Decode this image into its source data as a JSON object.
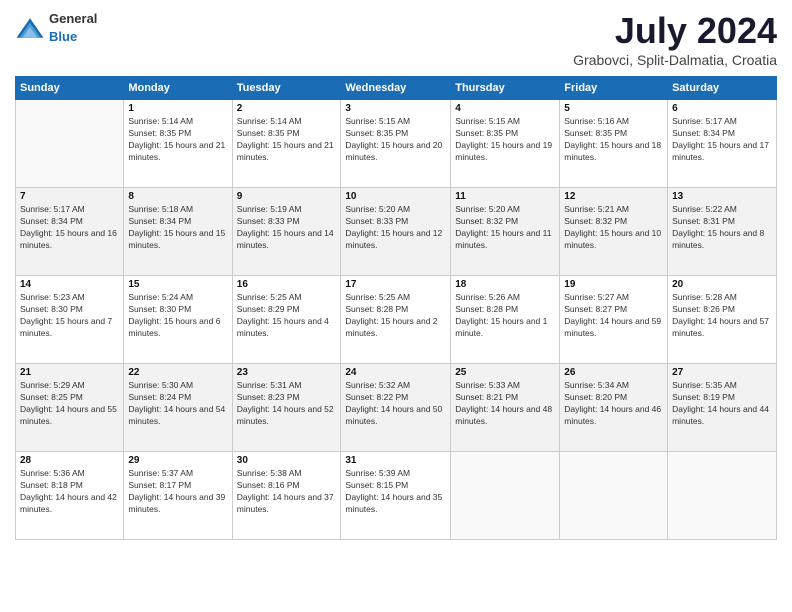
{
  "logo": {
    "general": "General",
    "blue": "Blue"
  },
  "title": "July 2024",
  "subtitle": "Grabovci, Split-Dalmatia, Croatia",
  "weekdays": [
    "Sunday",
    "Monday",
    "Tuesday",
    "Wednesday",
    "Thursday",
    "Friday",
    "Saturday"
  ],
  "weeks": [
    [
      {
        "day": "",
        "sunrise": "",
        "sunset": "",
        "daylight": ""
      },
      {
        "day": "1",
        "sunrise": "Sunrise: 5:14 AM",
        "sunset": "Sunset: 8:35 PM",
        "daylight": "Daylight: 15 hours and 21 minutes."
      },
      {
        "day": "2",
        "sunrise": "Sunrise: 5:14 AM",
        "sunset": "Sunset: 8:35 PM",
        "daylight": "Daylight: 15 hours and 21 minutes."
      },
      {
        "day": "3",
        "sunrise": "Sunrise: 5:15 AM",
        "sunset": "Sunset: 8:35 PM",
        "daylight": "Daylight: 15 hours and 20 minutes."
      },
      {
        "day": "4",
        "sunrise": "Sunrise: 5:15 AM",
        "sunset": "Sunset: 8:35 PM",
        "daylight": "Daylight: 15 hours and 19 minutes."
      },
      {
        "day": "5",
        "sunrise": "Sunrise: 5:16 AM",
        "sunset": "Sunset: 8:35 PM",
        "daylight": "Daylight: 15 hours and 18 minutes."
      },
      {
        "day": "6",
        "sunrise": "Sunrise: 5:17 AM",
        "sunset": "Sunset: 8:34 PM",
        "daylight": "Daylight: 15 hours and 17 minutes."
      }
    ],
    [
      {
        "day": "7",
        "sunrise": "Sunrise: 5:17 AM",
        "sunset": "Sunset: 8:34 PM",
        "daylight": "Daylight: 15 hours and 16 minutes."
      },
      {
        "day": "8",
        "sunrise": "Sunrise: 5:18 AM",
        "sunset": "Sunset: 8:34 PM",
        "daylight": "Daylight: 15 hours and 15 minutes."
      },
      {
        "day": "9",
        "sunrise": "Sunrise: 5:19 AM",
        "sunset": "Sunset: 8:33 PM",
        "daylight": "Daylight: 15 hours and 14 minutes."
      },
      {
        "day": "10",
        "sunrise": "Sunrise: 5:20 AM",
        "sunset": "Sunset: 8:33 PM",
        "daylight": "Daylight: 15 hours and 12 minutes."
      },
      {
        "day": "11",
        "sunrise": "Sunrise: 5:20 AM",
        "sunset": "Sunset: 8:32 PM",
        "daylight": "Daylight: 15 hours and 11 minutes."
      },
      {
        "day": "12",
        "sunrise": "Sunrise: 5:21 AM",
        "sunset": "Sunset: 8:32 PM",
        "daylight": "Daylight: 15 hours and 10 minutes."
      },
      {
        "day": "13",
        "sunrise": "Sunrise: 5:22 AM",
        "sunset": "Sunset: 8:31 PM",
        "daylight": "Daylight: 15 hours and 8 minutes."
      }
    ],
    [
      {
        "day": "14",
        "sunrise": "Sunrise: 5:23 AM",
        "sunset": "Sunset: 8:30 PM",
        "daylight": "Daylight: 15 hours and 7 minutes."
      },
      {
        "day": "15",
        "sunrise": "Sunrise: 5:24 AM",
        "sunset": "Sunset: 8:30 PM",
        "daylight": "Daylight: 15 hours and 6 minutes."
      },
      {
        "day": "16",
        "sunrise": "Sunrise: 5:25 AM",
        "sunset": "Sunset: 8:29 PM",
        "daylight": "Daylight: 15 hours and 4 minutes."
      },
      {
        "day": "17",
        "sunrise": "Sunrise: 5:25 AM",
        "sunset": "Sunset: 8:28 PM",
        "daylight": "Daylight: 15 hours and 2 minutes."
      },
      {
        "day": "18",
        "sunrise": "Sunrise: 5:26 AM",
        "sunset": "Sunset: 8:28 PM",
        "daylight": "Daylight: 15 hours and 1 minute."
      },
      {
        "day": "19",
        "sunrise": "Sunrise: 5:27 AM",
        "sunset": "Sunset: 8:27 PM",
        "daylight": "Daylight: 14 hours and 59 minutes."
      },
      {
        "day": "20",
        "sunrise": "Sunrise: 5:28 AM",
        "sunset": "Sunset: 8:26 PM",
        "daylight": "Daylight: 14 hours and 57 minutes."
      }
    ],
    [
      {
        "day": "21",
        "sunrise": "Sunrise: 5:29 AM",
        "sunset": "Sunset: 8:25 PM",
        "daylight": "Daylight: 14 hours and 55 minutes."
      },
      {
        "day": "22",
        "sunrise": "Sunrise: 5:30 AM",
        "sunset": "Sunset: 8:24 PM",
        "daylight": "Daylight: 14 hours and 54 minutes."
      },
      {
        "day": "23",
        "sunrise": "Sunrise: 5:31 AM",
        "sunset": "Sunset: 8:23 PM",
        "daylight": "Daylight: 14 hours and 52 minutes."
      },
      {
        "day": "24",
        "sunrise": "Sunrise: 5:32 AM",
        "sunset": "Sunset: 8:22 PM",
        "daylight": "Daylight: 14 hours and 50 minutes."
      },
      {
        "day": "25",
        "sunrise": "Sunrise: 5:33 AM",
        "sunset": "Sunset: 8:21 PM",
        "daylight": "Daylight: 14 hours and 48 minutes."
      },
      {
        "day": "26",
        "sunrise": "Sunrise: 5:34 AM",
        "sunset": "Sunset: 8:20 PM",
        "daylight": "Daylight: 14 hours and 46 minutes."
      },
      {
        "day": "27",
        "sunrise": "Sunrise: 5:35 AM",
        "sunset": "Sunset: 8:19 PM",
        "daylight": "Daylight: 14 hours and 44 minutes."
      }
    ],
    [
      {
        "day": "28",
        "sunrise": "Sunrise: 5:36 AM",
        "sunset": "Sunset: 8:18 PM",
        "daylight": "Daylight: 14 hours and 42 minutes."
      },
      {
        "day": "29",
        "sunrise": "Sunrise: 5:37 AM",
        "sunset": "Sunset: 8:17 PM",
        "daylight": "Daylight: 14 hours and 39 minutes."
      },
      {
        "day": "30",
        "sunrise": "Sunrise: 5:38 AM",
        "sunset": "Sunset: 8:16 PM",
        "daylight": "Daylight: 14 hours and 37 minutes."
      },
      {
        "day": "31",
        "sunrise": "Sunrise: 5:39 AM",
        "sunset": "Sunset: 8:15 PM",
        "daylight": "Daylight: 14 hours and 35 minutes."
      },
      {
        "day": "",
        "sunrise": "",
        "sunset": "",
        "daylight": ""
      },
      {
        "day": "",
        "sunrise": "",
        "sunset": "",
        "daylight": ""
      },
      {
        "day": "",
        "sunrise": "",
        "sunset": "",
        "daylight": ""
      }
    ]
  ]
}
